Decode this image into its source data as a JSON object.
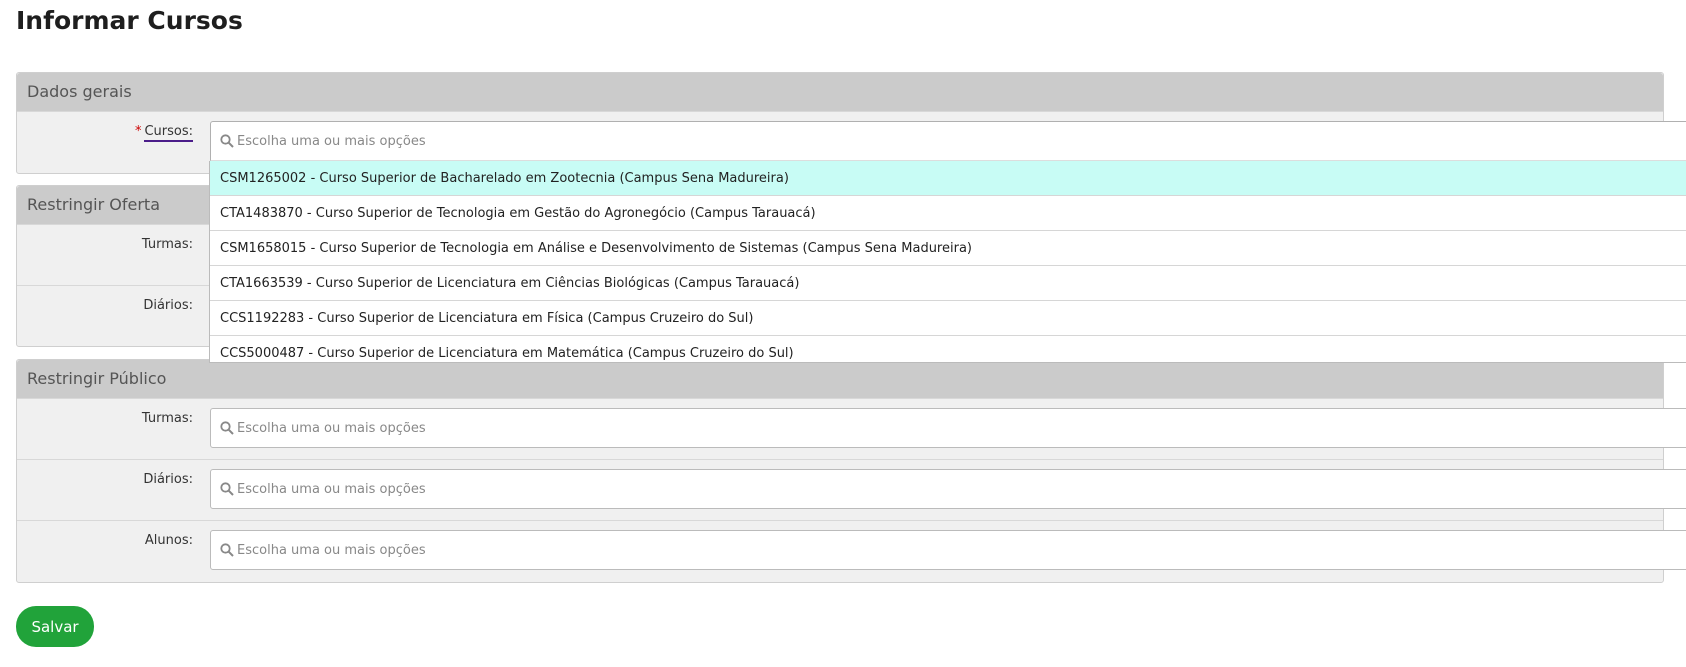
{
  "page": {
    "title": "Informar Cursos"
  },
  "dados_gerais": {
    "header": "Dados gerais",
    "cursos": {
      "required_mark": "*",
      "label": "Cursos:",
      "placeholder": "Escolha uma ou mais opções",
      "options": [
        "CSM1265002 - Curso Superior de Bacharelado em Zootecnia (Campus Sena Madureira)",
        "CTA1483870 - Curso Superior de Tecnologia em Gestão do Agronegócio (Campus Tarauacá)",
        "CSM1658015 - Curso Superior de Tecnologia em Análise e Desenvolvimento de Sistemas (Campus Sena Madureira)",
        "CTA1663539 - Curso Superior de Licenciatura em Ciências Biológicas (Campus Tarauacá)",
        "CCS1192283 - Curso Superior de Licenciatura em Física (Campus Cruzeiro do Sul)",
        "CCS5000487 - Curso Superior de Licenciatura em Matemática (Campus Cruzeiro do Sul)"
      ]
    }
  },
  "restringir_oferta": {
    "header": "Restringir Oferta",
    "turmas_label": "Turmas:",
    "diarios_label": "Diários:"
  },
  "restringir_publico": {
    "header": "Restringir Público",
    "turmas": {
      "label": "Turmas:",
      "placeholder": "Escolha uma ou mais opções"
    },
    "diarios": {
      "label": "Diários:",
      "placeholder": "Escolha uma ou mais opções"
    },
    "alunos": {
      "label": "Alunos:",
      "placeholder": "Escolha uma ou mais opções"
    }
  },
  "actions": {
    "save_label": "Salvar"
  },
  "colors": {
    "save_button": "#21a33a",
    "highlight": "#c8fcf5",
    "header_bg": "#cbcbcb",
    "required": "#cc0000"
  },
  "icons": {
    "search": "search-icon"
  }
}
